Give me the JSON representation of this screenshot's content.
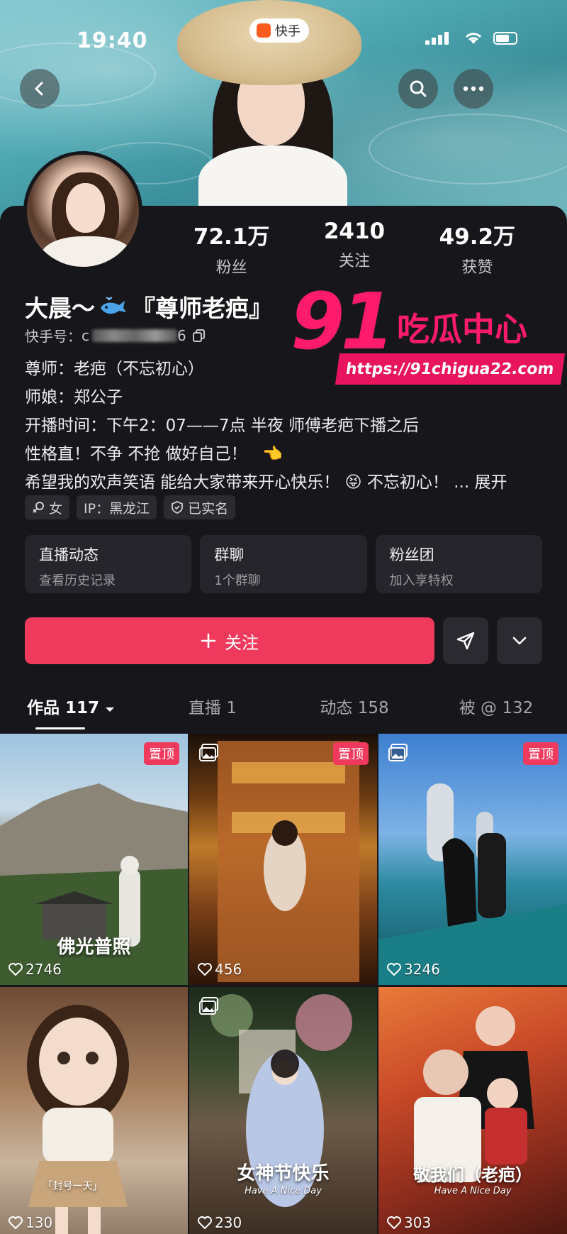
{
  "status_bar": {
    "time": "19:40",
    "app_name": "快手"
  },
  "header": {
    "back_icon": "chevron-left-icon",
    "search_icon": "search-icon",
    "more_icon": "more-icon"
  },
  "profile": {
    "stats": [
      {
        "value": "72.1万",
        "label": "粉丝"
      },
      {
        "value": "2410",
        "label": "关注"
      },
      {
        "value": "49.2万",
        "label": "获赞"
      }
    ],
    "name_prefix": "大晨～",
    "name_suffix": "『尊师老疤』",
    "kuaishou_id_label": "快手号：",
    "kuaishou_id_start": "c",
    "kuaishou_id_end": "6",
    "bio": [
      "尊师：老疤（不忘初心）",
      "师娘：郑公子",
      "开播时间：下午2：07——7点  半夜 师傅老疤下播之后",
      "性格直！不争 不抢  做好自己！",
      "希望我的欢声笑语 能给大家带来开心快乐！"
    ],
    "bio_last_suffix": "不忘初心！ ...",
    "expand_label": "展开",
    "tags": [
      "女",
      "IP：黑龙江",
      "已实名"
    ]
  },
  "features": [
    {
      "title": "直播动态",
      "subtitle": "查看历史记录"
    },
    {
      "title": "群聊",
      "subtitle": "1个群聊"
    },
    {
      "title": "粉丝团",
      "subtitle": "加入享特权"
    }
  ],
  "actions": {
    "follow_label": "关注"
  },
  "tabs": [
    {
      "label": "作品 117"
    },
    {
      "label": "直播 1"
    },
    {
      "label": "动态 158"
    },
    {
      "label": "被 @ 132"
    }
  ],
  "grid": [
    {
      "likes": "2746",
      "pinned": "置顶",
      "caption": "佛光普照"
    },
    {
      "likes": "456",
      "pinned": "置顶"
    },
    {
      "likes": "3246",
      "pinned": "置顶"
    },
    {
      "likes": "130",
      "caption": "「封号一天」"
    },
    {
      "likes": "230",
      "caption": "女神节快乐",
      "subcaption": "Have A Nice Day"
    },
    {
      "likes": "303",
      "caption": "敬我们（老疤）",
      "subcaption": "Have A Nice Day"
    }
  ],
  "watermark": {
    "number": "91",
    "text": "吃瓜中心",
    "url": "https://91chigua22.com"
  },
  "colors": {
    "accent": "#ef3a5d",
    "background": "#17171b",
    "watermark": "#ff1b6b"
  }
}
